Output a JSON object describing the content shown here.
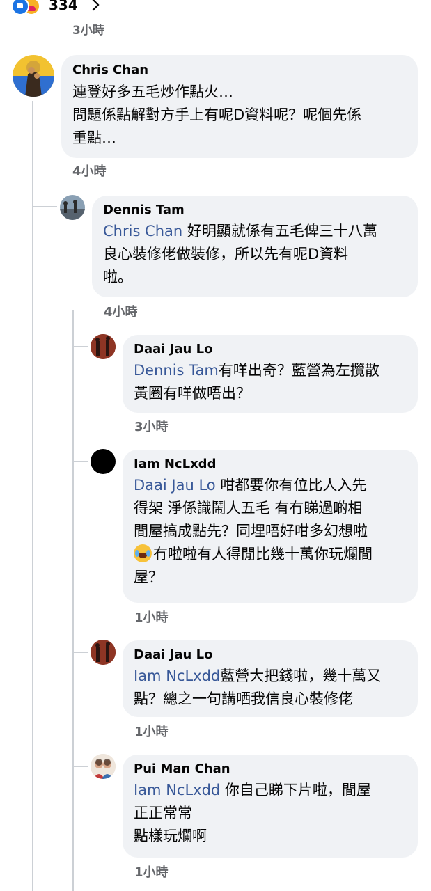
{
  "reactions": {
    "count": "334",
    "icons": [
      "like-icon",
      "care-icon"
    ],
    "chevron": "chevron-right-icon"
  },
  "top_timestamp": "3小時",
  "colors": {
    "bubble": "#f0f2f5",
    "mention": "#385898",
    "secondary_text": "#65676b",
    "thread_line": "#ccd0d5"
  },
  "comments": [
    {
      "author": "Chris Chan",
      "lines": [
        "連登好多五毛炒作點火…",
        "問題係點解對方手上有呢D資料呢？呢個先係",
        "重點…"
      ],
      "timestamp": "4小時"
    },
    {
      "author": "Dennis Tam",
      "mention": "Chris Chan",
      "lines": [
        " 好明顯就係有五毛俾三十八萬",
        "良心裝修佬做裝修，所以先有呢D資料",
        "啦。"
      ],
      "timestamp": "4小時"
    },
    {
      "author": "Daai Jau Lo",
      "mention": "Dennis Tam",
      "lines": [
        "有咩出奇？藍營為左攬散",
        "黃圈有咩做唔出？"
      ],
      "timestamp": "3小時"
    },
    {
      "author": "Iam NcLxdd",
      "mention": "Daai Jau Lo",
      "lines": [
        " 咁都要你有位比人入先",
        "得架 淨係識鬧人五毛 有冇睇過啲相",
        "間屋搞成點先？同埋唔好咁多幻想啦",
        "冇啦啦有人得閒比幾十萬你玩爛間",
        "屋？"
      ],
      "emoji": "crying-laughing-emoji-icon",
      "timestamp": "1小時"
    },
    {
      "author": "Daai Jau Lo",
      "mention": "Iam NcLxdd",
      "lines": [
        "藍營大把錢啦，幾十萬又",
        "點？總之一句講哂我信良心裝修佬"
      ],
      "timestamp": "1小時"
    },
    {
      "author": "Pui Man Chan",
      "mention": "Iam NcLxdd",
      "lines": [
        " 你自己睇下片啦，間屋",
        "正正常常",
        "點樣玩爛啊"
      ],
      "timestamp": "1小時"
    }
  ]
}
